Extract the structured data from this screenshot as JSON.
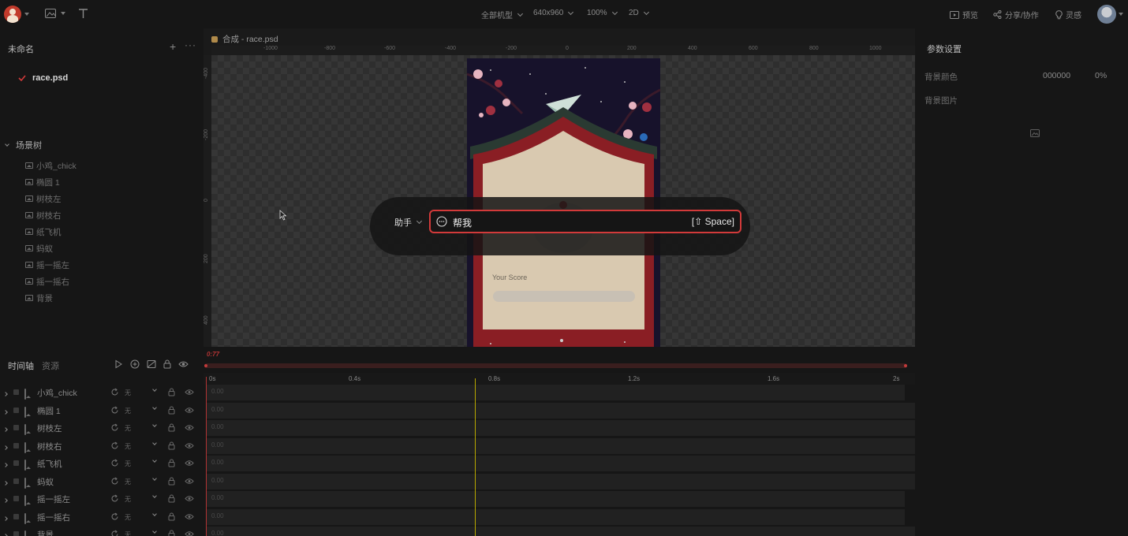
{
  "topbar": {
    "device": "全部机型",
    "resolution": "640x960",
    "zoom": "100%",
    "mode": "2D",
    "preview": "预览",
    "share": "分享/协作",
    "inspiration": "灵感"
  },
  "project": {
    "name": "未命名",
    "file": "race.psd"
  },
  "scene_tree": {
    "title": "场景树",
    "items": [
      "小鸡_chick",
      "椭圆 1",
      "树枝左",
      "树枝右",
      "纸飞机",
      "蚂蚁",
      "摇一摇左",
      "摇一摇右",
      "背景"
    ]
  },
  "canvas": {
    "tab": "合成 - race.psd",
    "ruler_h": [
      "-1000",
      "-800",
      "-600",
      "-400",
      "-200",
      "0",
      "200",
      "400",
      "600",
      "800",
      "1000"
    ],
    "ruler_v": [
      "-400",
      "-200",
      "0",
      "200",
      "400"
    ],
    "score_label": "Your Score"
  },
  "assistant": {
    "mode": "助手",
    "input": "帮我",
    "shortcut": "[⇧ Space]"
  },
  "right": {
    "title": "参数设置",
    "bg_color_label": "背景颜色",
    "bg_color_value": "000000",
    "bg_opacity": "0%",
    "bg_image_label": "背景图片"
  },
  "timeline": {
    "tab_timeline": "时间轴",
    "tab_assets": "资源",
    "current_time": "0:77",
    "ticks": [
      "0s",
      "0.4s",
      "0.8s",
      "1.2s",
      "1.6s",
      "2s"
    ],
    "ease": "无",
    "track_value": "0.00",
    "tracks": [
      "小鸡_chick",
      "椭圆 1",
      "树枝左",
      "树枝右",
      "纸飞机",
      "蚂蚁",
      "摇一摇左",
      "摇一摇右",
      "背景"
    ]
  },
  "colors": {
    "accent": "#d23a3a",
    "playhead": "#c8b400"
  }
}
